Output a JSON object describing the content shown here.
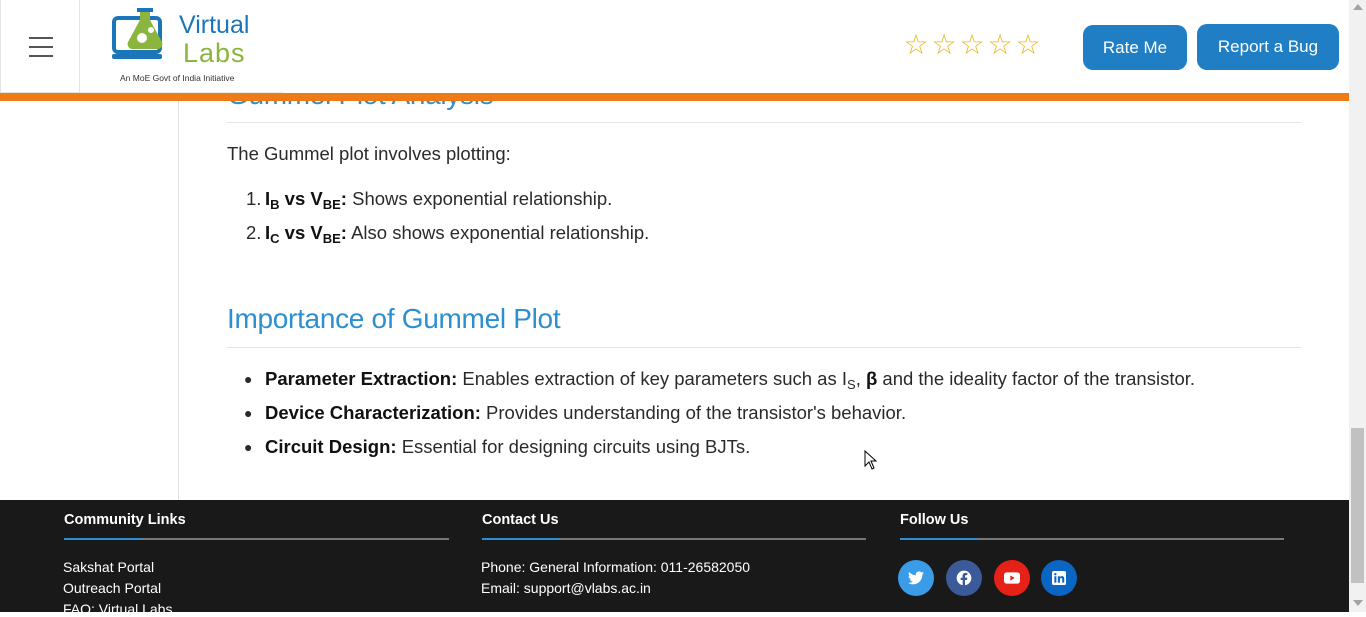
{
  "header": {
    "logo": {
      "title_line1": "Virtual",
      "title_line2": "Labs",
      "subtitle": "An MoE Govt of India Initiative"
    },
    "rating": {
      "stars": [
        "☆",
        "☆",
        "☆",
        "☆",
        "☆"
      ],
      "filled": 0,
      "max": 5
    },
    "rate_button": "Rate Me",
    "bug_button": "Report a Bug"
  },
  "article": {
    "section1_title": "Gummel Plot Analysis",
    "intro": "The Gummel plot involves plotting:",
    "list": [
      {
        "num": "1.",
        "a": "I",
        "a_sub": "B",
        "vs": " vs V",
        "b_sub": "BE",
        "sep": ":",
        "text": " Shows exponential relationship."
      },
      {
        "num": "2.",
        "a": "I",
        "a_sub": "C",
        "vs": " vs V",
        "b_sub": "BE",
        "sep": ":",
        "text": " Also shows exponential relationship."
      }
    ],
    "section2_title": "Importance of Gummel Plot",
    "bullets": [
      {
        "term": "Parameter Extraction:",
        "text_pre": " Enables extraction of key parameters such as I",
        "sub": "S",
        "text_mid": ", ",
        "beta": "β",
        "text_post": " and the ideality factor of the transistor."
      },
      {
        "term": "Device Characterization:",
        "text": " Provides understanding of the transistor's behavior."
      },
      {
        "term": "Circuit Design:",
        "text": " Essential for designing circuits using BJTs."
      }
    ]
  },
  "footer": {
    "community": {
      "title": "Community Links",
      "links": [
        "Sakshat Portal",
        "Outreach Portal",
        "FAQ: Virtual Labs"
      ]
    },
    "contact": {
      "title": "Contact Us",
      "phone": "Phone: General Information: 011-26582050",
      "email": "Email: support@vlabs.ac.in"
    },
    "follow": {
      "title": "Follow Us",
      "icons": [
        "twitter-icon",
        "facebook-icon",
        "youtube-icon",
        "linkedin-icon"
      ]
    }
  },
  "colors": {
    "accent": "#1f7ec4",
    "heading": "#2c8fcf",
    "orange_bar": "#f07a18",
    "footer_bg": "#191919",
    "twitter": "#3a9be6",
    "facebook": "#3b5a99",
    "youtube": "#e62117",
    "linkedin": "#0a66c2"
  }
}
